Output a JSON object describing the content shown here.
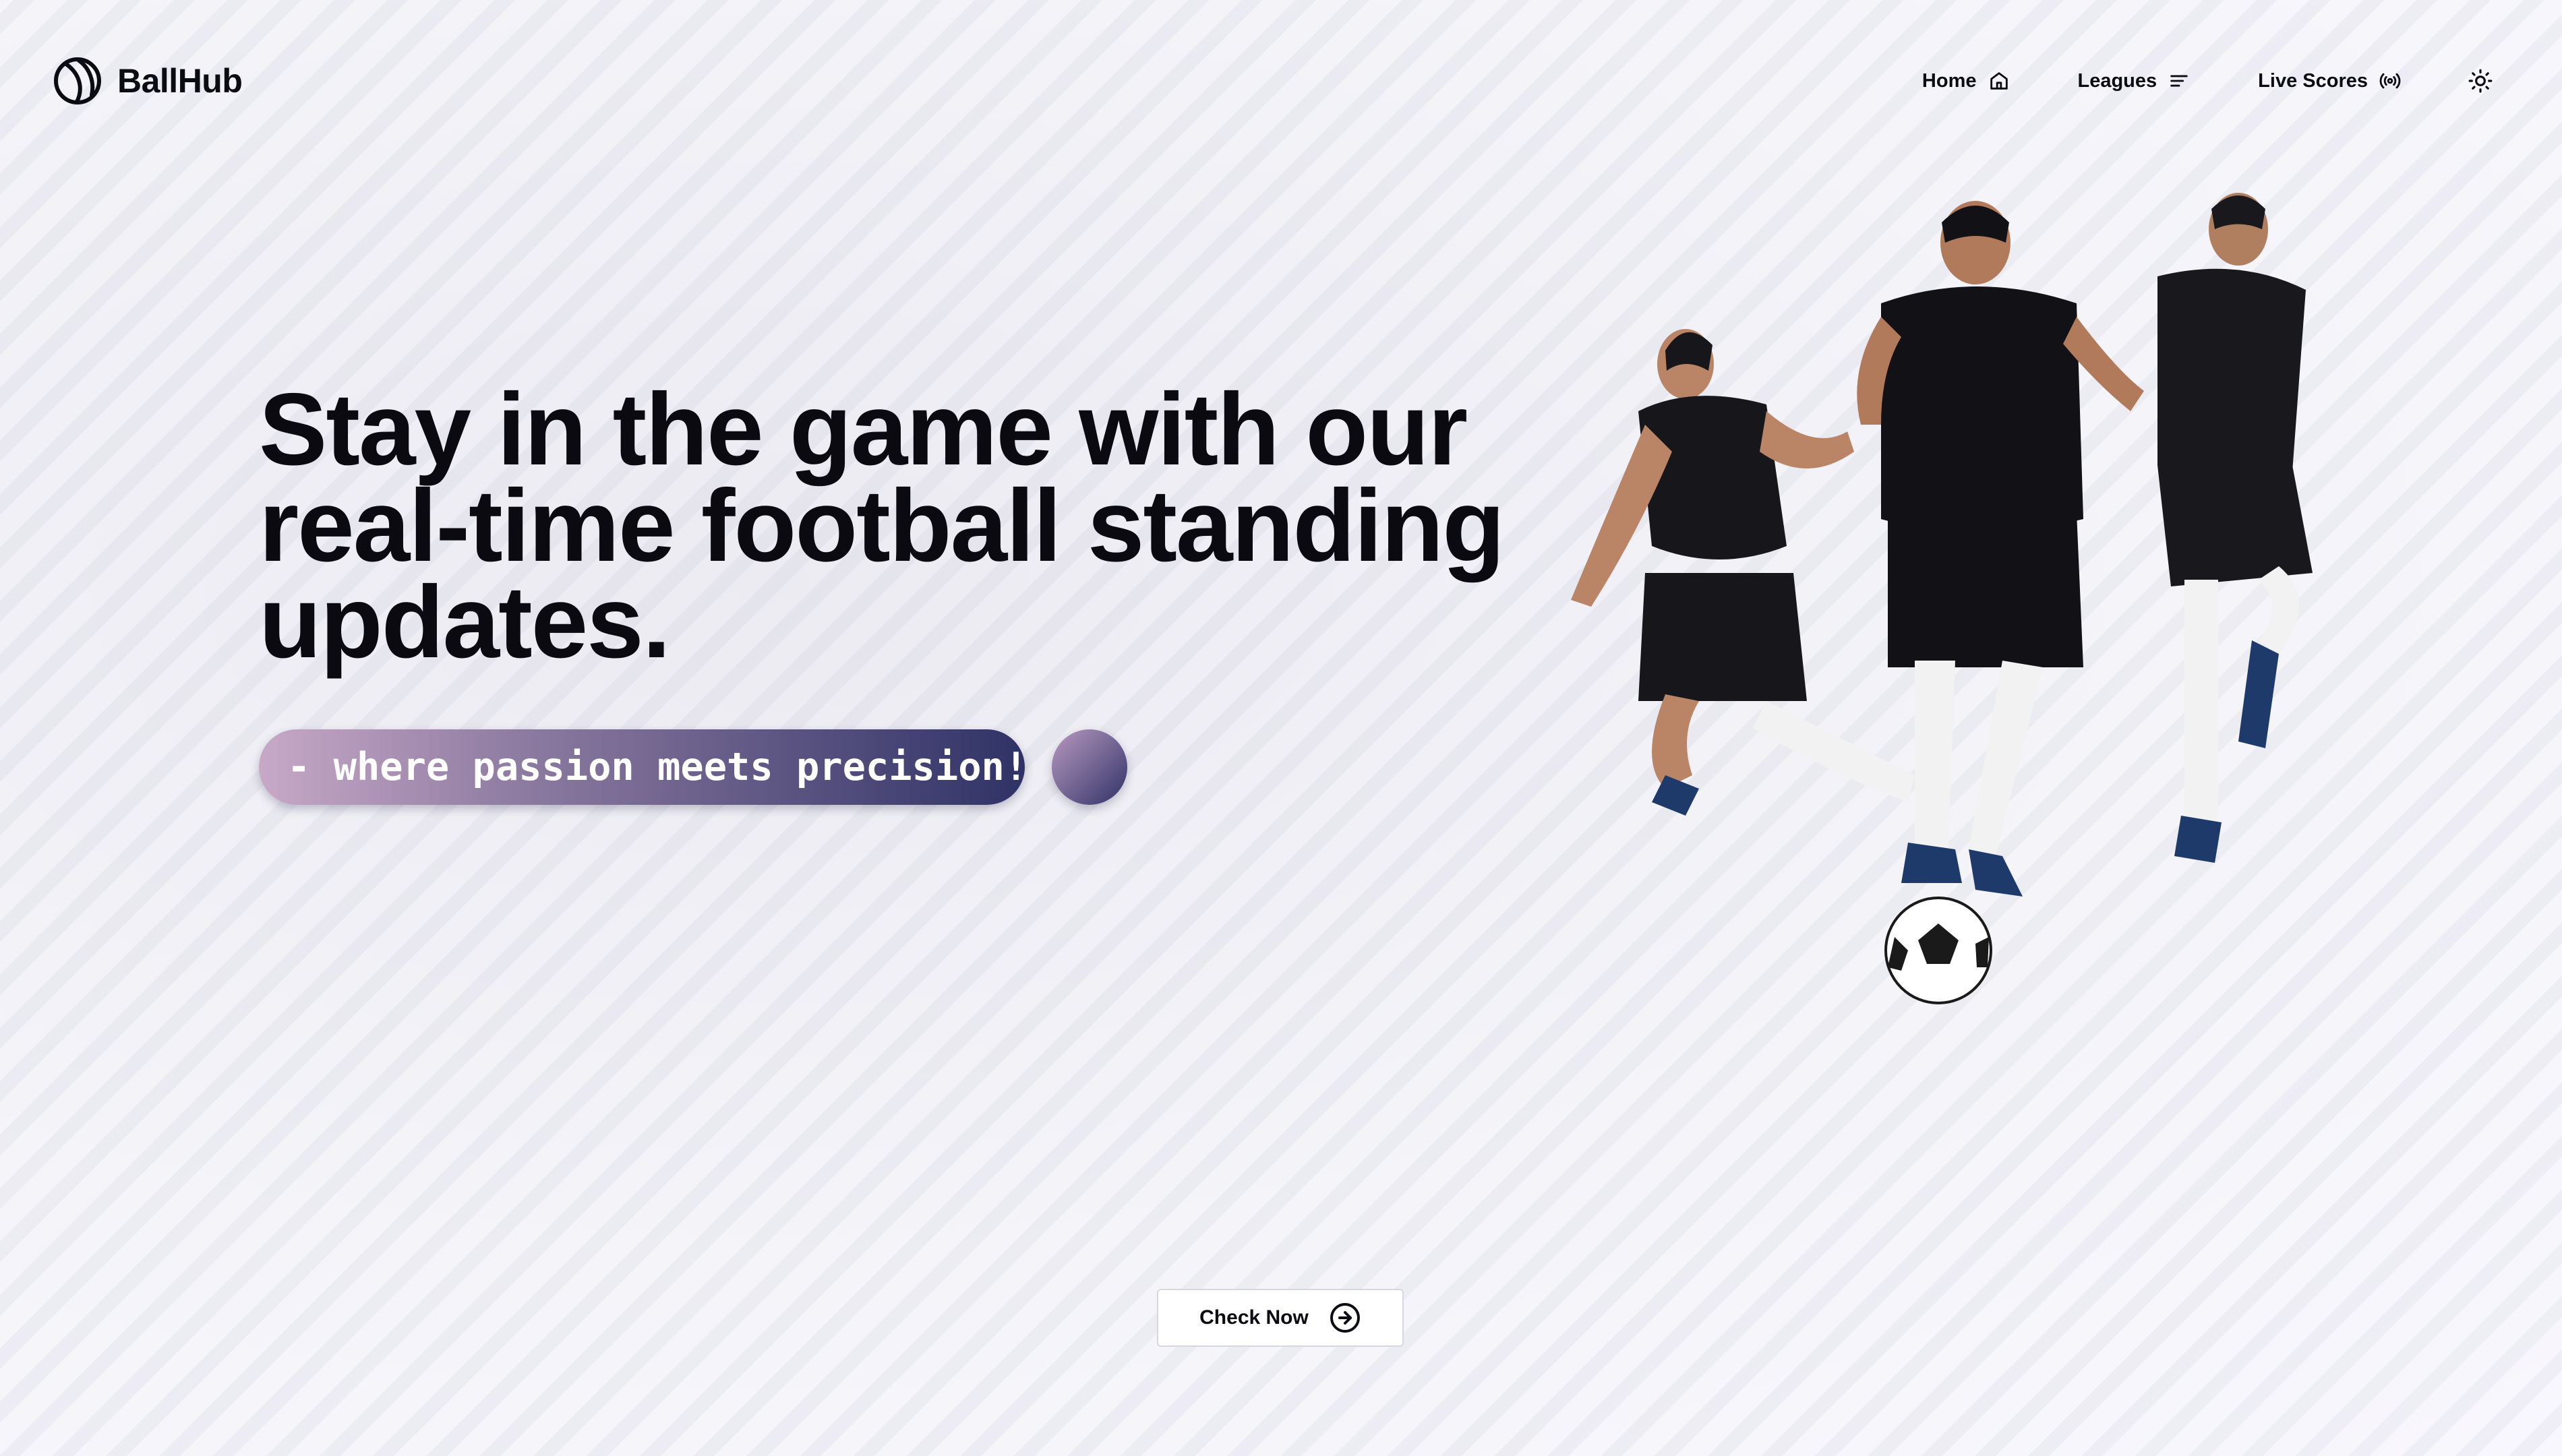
{
  "brand": {
    "name": "BallHub",
    "logo_icon": "football-outline-logo"
  },
  "nav": {
    "home_label": "Home",
    "home_icon": "home-icon",
    "leagues_label": "Leagues",
    "leagues_icon": "menu-lines-icon",
    "live_label": "Live Scores",
    "live_icon": "broadcast-icon",
    "theme_icon": "sun-icon"
  },
  "hero": {
    "line1": "Stay in the game with our",
    "line2": "real-time football standing",
    "line3": "updates.",
    "tagline": "- where passion meets precision!"
  },
  "cta": {
    "label": "Check Now",
    "icon": "arrow-circle-right-icon"
  },
  "colors": {
    "gradient_start": "#c7a8c7",
    "gradient_end": "#2f3266",
    "text": "#0a0a10",
    "background": "#f4f4f9"
  }
}
